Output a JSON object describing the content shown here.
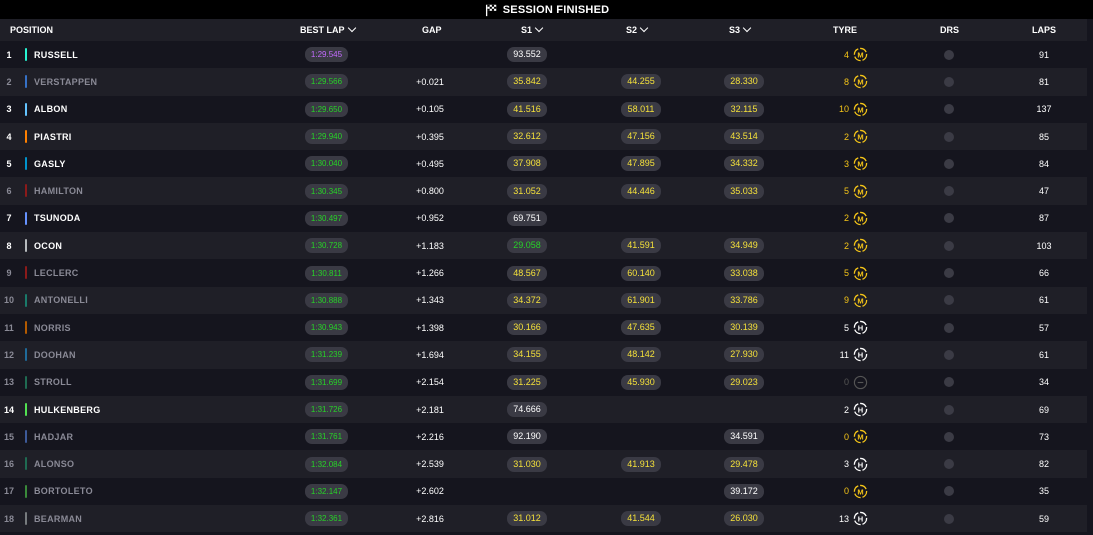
{
  "session": {
    "title": "SESSION FINISHED",
    "icon": "checkered-flag-icon"
  },
  "columns": {
    "position": "POSITION",
    "best_lap": "BEST LAP",
    "gap": "GAP",
    "s1": "S1",
    "s2": "S2",
    "s3": "S3",
    "tyre": "TYRE",
    "drs": "DRS",
    "laps": "LAPS"
  },
  "colors": {
    "personal_best": "#27d227",
    "overall_best": "#c36bff",
    "yellow": "#f5e13a",
    "medium_tyre": "#f5c518",
    "hard_tyre": "#ffffff",
    "dim_text": "#8a8a96"
  },
  "rows": [
    {
      "pos": "1",
      "name": "RUSSELL",
      "team_color": "#27f4d2",
      "dim": false,
      "best_lap": "1:29.545",
      "lap_color": "#c36bff",
      "gap": "",
      "s1": "93.552",
      "s1_color": "#ffffff",
      "s2": "",
      "s2_color": "#f5e13a",
      "s3": "",
      "s3_color": "#f5e13a",
      "tyre_age": "4",
      "tyre": "medium",
      "laps": "91"
    },
    {
      "pos": "2",
      "name": "VERSTAPPEN",
      "team_color": "#3671c6",
      "dim": true,
      "best_lap": "1:29.566",
      "lap_color": "#27d227",
      "gap": "+0.021",
      "s1": "35.842",
      "s1_color": "#f5e13a",
      "s2": "44.255",
      "s2_color": "#f5e13a",
      "s3": "28.330",
      "s3_color": "#f5e13a",
      "tyre_age": "8",
      "tyre": "medium",
      "laps": "81"
    },
    {
      "pos": "3",
      "name": "ALBON",
      "team_color": "#64c4ff",
      "dim": false,
      "best_lap": "1:29.650",
      "lap_color": "#27d227",
      "gap": "+0.105",
      "s1": "41.516",
      "s1_color": "#f5e13a",
      "s2": "58.011",
      "s2_color": "#f5e13a",
      "s3": "32.115",
      "s3_color": "#f5e13a",
      "tyre_age": "10",
      "tyre": "medium",
      "laps": "137"
    },
    {
      "pos": "4",
      "name": "PIASTRI",
      "team_color": "#ff8000",
      "dim": false,
      "best_lap": "1:29.940",
      "lap_color": "#27d227",
      "gap": "+0.395",
      "s1": "32.612",
      "s1_color": "#f5e13a",
      "s2": "47.156",
      "s2_color": "#f5e13a",
      "s3": "43.514",
      "s3_color": "#f5e13a",
      "tyre_age": "2",
      "tyre": "medium",
      "laps": "85"
    },
    {
      "pos": "5",
      "name": "GASLY",
      "team_color": "#0093cc",
      "dim": false,
      "best_lap": "1:30.040",
      "lap_color": "#27d227",
      "gap": "+0.495",
      "s1": "37.908",
      "s1_color": "#f5e13a",
      "s2": "47.895",
      "s2_color": "#f5e13a",
      "s3": "34.332",
      "s3_color": "#f5e13a",
      "tyre_age": "3",
      "tyre": "medium",
      "laps": "84"
    },
    {
      "pos": "6",
      "name": "HAMILTON",
      "team_color": "#8b1a1a",
      "dim": true,
      "best_lap": "1:30.345",
      "lap_color": "#27d227",
      "gap": "+0.800",
      "s1": "31.052",
      "s1_color": "#f5e13a",
      "s2": "44.446",
      "s2_color": "#f5e13a",
      "s3": "35.033",
      "s3_color": "#f5e13a",
      "tyre_age": "5",
      "tyre": "medium",
      "laps": "47"
    },
    {
      "pos": "7",
      "name": "TSUNODA",
      "team_color": "#6692ff",
      "dim": false,
      "best_lap": "1:30.497",
      "lap_color": "#27d227",
      "gap": "+0.952",
      "s1": "69.751",
      "s1_color": "#ffffff",
      "s2": "",
      "s2_color": "#f5e13a",
      "s3": "",
      "s3_color": "#f5e13a",
      "tyre_age": "2",
      "tyre": "medium",
      "laps": "87"
    },
    {
      "pos": "8",
      "name": "OCON",
      "team_color": "#b6babd",
      "dim": false,
      "best_lap": "1:30.728",
      "lap_color": "#27d227",
      "gap": "+1.183",
      "s1": "29.058",
      "s1_color": "#27d227",
      "s2": "41.591",
      "s2_color": "#f5e13a",
      "s3": "34.949",
      "s3_color": "#f5e13a",
      "tyre_age": "2",
      "tyre": "medium",
      "laps": "103"
    },
    {
      "pos": "9",
      "name": "LECLERC",
      "team_color": "#8b1a1a",
      "dim": true,
      "best_lap": "1:30.811",
      "lap_color": "#27d227",
      "gap": "+1.266",
      "s1": "48.567",
      "s1_color": "#f5e13a",
      "s2": "60.140",
      "s2_color": "#f5e13a",
      "s3": "33.038",
      "s3_color": "#f5e13a",
      "tyre_age": "5",
      "tyre": "medium",
      "laps": "66"
    },
    {
      "pos": "10",
      "name": "ANTONELLI",
      "team_color": "#1a7a6a",
      "dim": true,
      "best_lap": "1:30.888",
      "lap_color": "#27d227",
      "gap": "+1.343",
      "s1": "34.372",
      "s1_color": "#f5e13a",
      "s2": "61.901",
      "s2_color": "#f5e13a",
      "s3": "33.786",
      "s3_color": "#f5e13a",
      "tyre_age": "9",
      "tyre": "medium",
      "laps": "61"
    },
    {
      "pos": "11",
      "name": "NORRIS",
      "team_color": "#b35a00",
      "dim": true,
      "best_lap": "1:30.943",
      "lap_color": "#27d227",
      "gap": "+1.398",
      "s1": "30.166",
      "s1_color": "#f5e13a",
      "s2": "47.635",
      "s2_color": "#f5e13a",
      "s3": "30.139",
      "s3_color": "#f5e13a",
      "tyre_age": "5",
      "tyre": "hard",
      "laps": "57"
    },
    {
      "pos": "12",
      "name": "DOOHAN",
      "team_color": "#1f6a99",
      "dim": true,
      "best_lap": "1:31.239",
      "lap_color": "#27d227",
      "gap": "+1.694",
      "s1": "34.155",
      "s1_color": "#f5e13a",
      "s2": "48.142",
      "s2_color": "#f5e13a",
      "s3": "27.930",
      "s3_color": "#f5e13a",
      "tyre_age": "11",
      "tyre": "hard",
      "laps": "61"
    },
    {
      "pos": "13",
      "name": "STROLL",
      "team_color": "#1f6b52",
      "dim": true,
      "best_lap": "1:31.699",
      "lap_color": "#27d227",
      "gap": "+2.154",
      "s1": "31.225",
      "s1_color": "#f5e13a",
      "s2": "45.930",
      "s2_color": "#f5e13a",
      "s3": "29.023",
      "s3_color": "#f5e13a",
      "tyre_age": "0",
      "tyre": "unknown",
      "laps": "34"
    },
    {
      "pos": "14",
      "name": "HULKENBERG",
      "team_color": "#52e252",
      "dim": false,
      "best_lap": "1:31.726",
      "lap_color": "#27d227",
      "gap": "+2.181",
      "s1": "74.666",
      "s1_color": "#ffffff",
      "s2": "",
      "s2_color": "#f5e13a",
      "s3": "",
      "s3_color": "#f5e13a",
      "tyre_age": "2",
      "tyre": "hard",
      "laps": "69"
    },
    {
      "pos": "15",
      "name": "HADJAR",
      "team_color": "#3d5a99",
      "dim": true,
      "best_lap": "1:31.761",
      "lap_color": "#27d227",
      "gap": "+2.216",
      "s1": "92.190",
      "s1_color": "#ffffff",
      "s2": "",
      "s2_color": "#f5e13a",
      "s3": "34.591",
      "s3_color": "#ffffff",
      "tyre_age": "0",
      "tyre": "medium",
      "laps": "73"
    },
    {
      "pos": "16",
      "name": "ALONSO",
      "team_color": "#1f6b52",
      "dim": true,
      "best_lap": "1:32.084",
      "lap_color": "#27d227",
      "gap": "+2.539",
      "s1": "31.030",
      "s1_color": "#f5e13a",
      "s2": "41.913",
      "s2_color": "#f5e13a",
      "s3": "29.478",
      "s3_color": "#f5e13a",
      "tyre_age": "3",
      "tyre": "hard",
      "laps": "82"
    },
    {
      "pos": "17",
      "name": "BORTOLETO",
      "team_color": "#3a8a3a",
      "dim": true,
      "best_lap": "1:32.147",
      "lap_color": "#27d227",
      "gap": "+2.602",
      "s1": "",
      "s1_color": "#f5e13a",
      "s2": "",
      "s2_color": "#f5e13a",
      "s3": "39.172",
      "s3_color": "#ffffff",
      "tyre_age": "0",
      "tyre": "medium",
      "laps": "35"
    },
    {
      "pos": "18",
      "name": "BEARMAN",
      "team_color": "#777b7e",
      "dim": true,
      "best_lap": "1:32.361",
      "lap_color": "#27d227",
      "gap": "+2.816",
      "s1": "31.012",
      "s1_color": "#f5e13a",
      "s2": "41.544",
      "s2_color": "#f5e13a",
      "s3": "26.030",
      "s3_color": "#f5e13a",
      "tyre_age": "13",
      "tyre": "hard",
      "laps": "59"
    }
  ]
}
